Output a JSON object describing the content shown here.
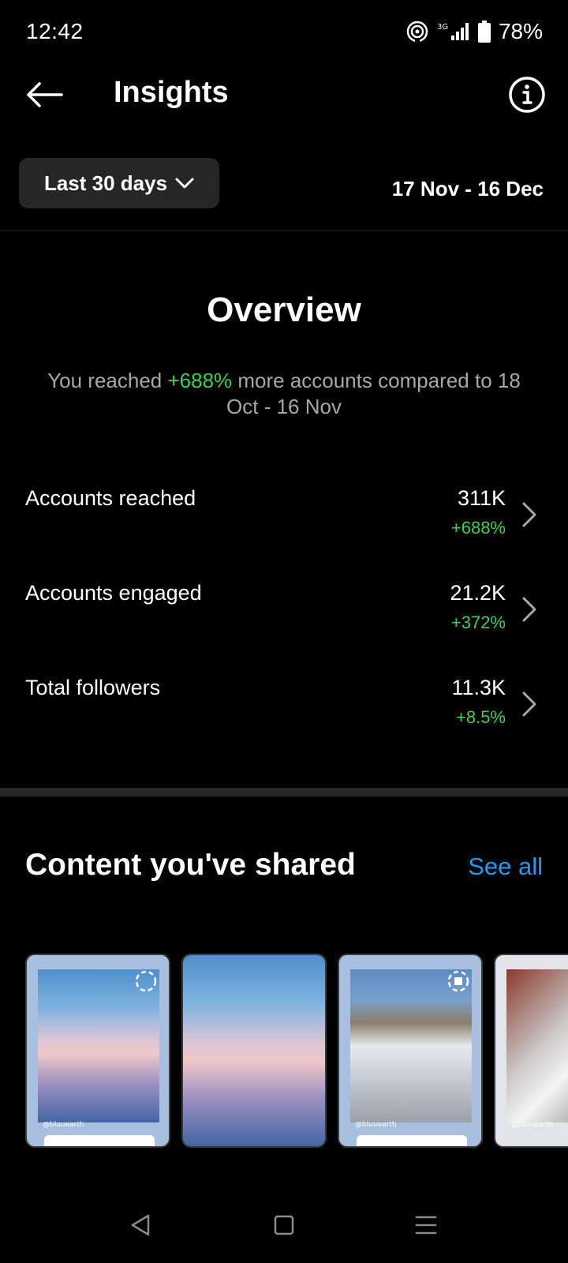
{
  "status_bar": {
    "time": "12:42",
    "network": "3G",
    "battery": "78%",
    "icons": [
      "hotspot-icon",
      "signal-icon",
      "battery-icon"
    ]
  },
  "header": {
    "title": "Insights",
    "back_icon": "arrow-left-icon",
    "info_icon": "info-icon"
  },
  "filter": {
    "range_label": "Last 30 days",
    "date_range": "17 Nov - 16 Dec"
  },
  "overview": {
    "title": "Overview",
    "sub_prefix": "You reached ",
    "sub_highlight": "+688%",
    "sub_suffix": " more accounts compared to 18 Oct - 16 Nov"
  },
  "metrics": [
    {
      "label": "Accounts reached",
      "value": "311K",
      "change": "+688%"
    },
    {
      "label": "Accounts engaged",
      "value": "21.2K",
      "change": "+372%"
    },
    {
      "label": "Total followers",
      "value": "11.3K",
      "change": "+8.5%"
    }
  ],
  "content": {
    "title": "Content you've shared",
    "see_all": "See all",
    "captions": [
      "@bluuearth",
      "@bluuearth",
      "@bluuearth"
    ]
  },
  "colors": {
    "background": "#000000",
    "positive": "#3ccf55",
    "link": "#1d9bf0",
    "surface": "#262626",
    "muted_text": "#a8a8a8"
  }
}
